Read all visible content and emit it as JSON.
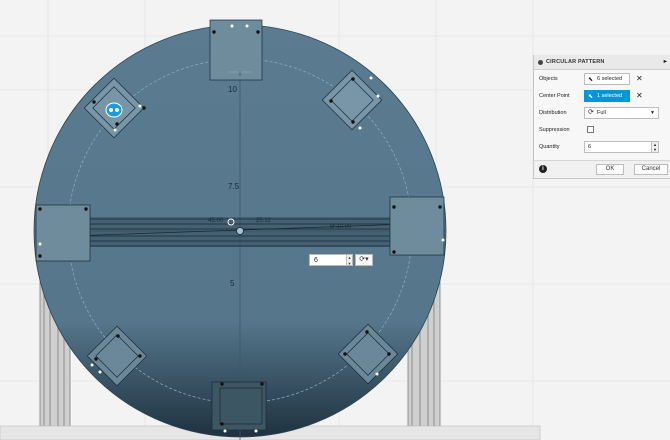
{
  "viewport": {
    "axis_labels": [
      "10",
      "7.5",
      "5"
    ],
    "dimension_labels": [
      "45.00",
      "25.12",
      "Ø 10.00"
    ],
    "qty_input": {
      "value": "6"
    }
  },
  "panel": {
    "title": "CIRCULAR PATTERN",
    "collapse_icon": "▸",
    "objects": {
      "label": "Objects",
      "value": "6 selected",
      "icon": "cursor-icon"
    },
    "center_point": {
      "label": "Center Point",
      "value": "1 selected",
      "icon": "cursor-icon"
    },
    "distribution": {
      "label": "Distribution",
      "value": "Full",
      "icon": "rotate-icon"
    },
    "suppression": {
      "label": "Suppression"
    },
    "quantity": {
      "label": "Quantity",
      "value": "6"
    },
    "ok_label": "OK",
    "cancel_label": "Cancel"
  },
  "colors": {
    "accent": "#0696d7",
    "disk": "#56778c",
    "panel_bg": "#f7f7f7"
  }
}
